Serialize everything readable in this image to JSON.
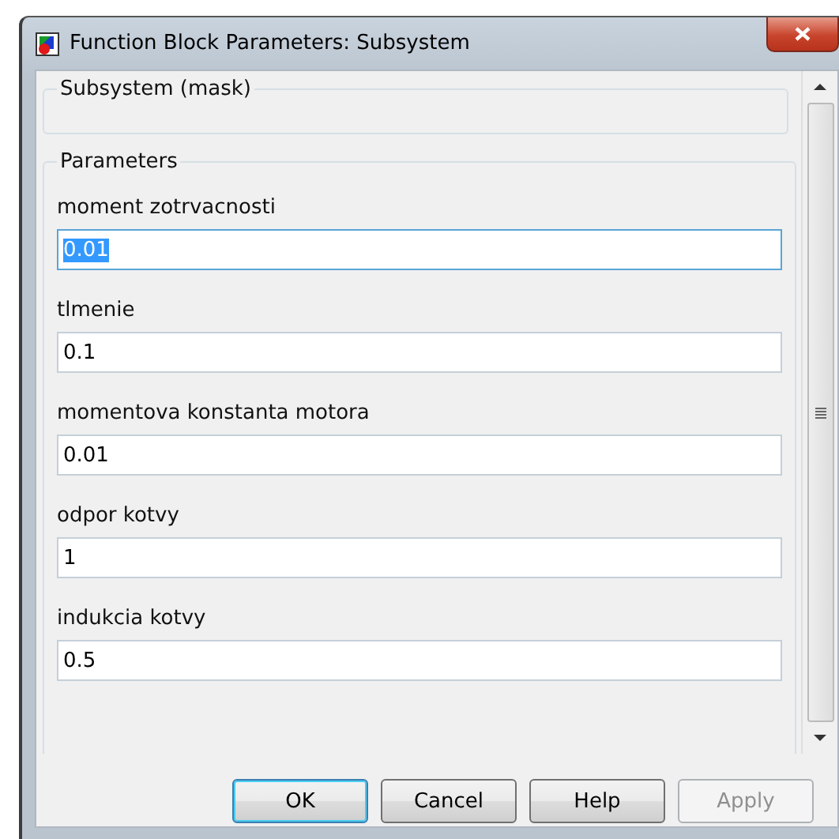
{
  "window": {
    "title": "Function Block Parameters: Subsystem"
  },
  "mask_group": {
    "title": "Subsystem (mask)"
  },
  "parameters_group": {
    "title": "Parameters",
    "fields": [
      {
        "label": "moment zotrvacnosti",
        "value": "0.01",
        "selected": true
      },
      {
        "label": "tlmenie",
        "value": "0.1",
        "selected": false
      },
      {
        "label": "momentova konstanta motora",
        "value": "0.01",
        "selected": false
      },
      {
        "label": "odpor kotvy",
        "value": "1",
        "selected": false
      },
      {
        "label": "indukcia kotvy",
        "value": "0.5",
        "selected": false
      }
    ]
  },
  "buttons": [
    {
      "label": "OK",
      "default": true,
      "disabled": false
    },
    {
      "label": "Cancel",
      "default": false,
      "disabled": false
    },
    {
      "label": "Help",
      "default": false,
      "disabled": false
    },
    {
      "label": "Apply",
      "default": false,
      "disabled": true
    }
  ]
}
